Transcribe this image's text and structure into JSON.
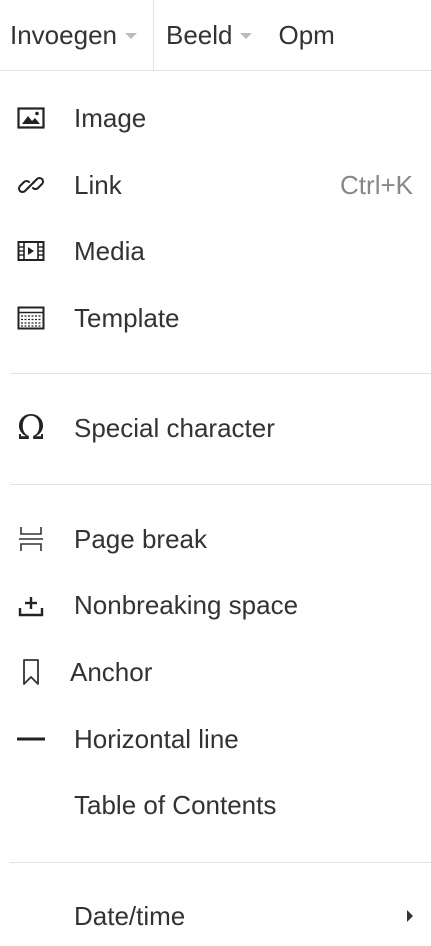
{
  "menubar": {
    "items": [
      {
        "label": "Invoegen"
      },
      {
        "label": "Beeld"
      },
      {
        "label": "Opm"
      }
    ]
  },
  "menu": {
    "items": [
      {
        "label": "Image",
        "icon": "image-icon"
      },
      {
        "label": "Link",
        "icon": "link-icon",
        "shortcut": "Ctrl+K"
      },
      {
        "label": "Media",
        "icon": "media-icon"
      },
      {
        "label": "Template",
        "icon": "template-icon"
      },
      {
        "label": "Special character",
        "icon": "omega-icon",
        "glyph": "Ω"
      },
      {
        "label": "Page break",
        "icon": "page-break-icon"
      },
      {
        "label": "Nonbreaking space",
        "icon": "nonbreaking-space-icon"
      },
      {
        "label": "Anchor",
        "icon": "bookmark-icon"
      },
      {
        "label": "Horizontal line",
        "icon": "horizontal-line-icon"
      },
      {
        "label": "Table of Contents"
      },
      {
        "label": "Date/time",
        "icon": "chevron-right-icon"
      }
    ]
  },
  "colors": {
    "text": "#333333",
    "shortcut": "#888888",
    "divider": "#e2e2e2",
    "caret": "#bbbbbb"
  }
}
